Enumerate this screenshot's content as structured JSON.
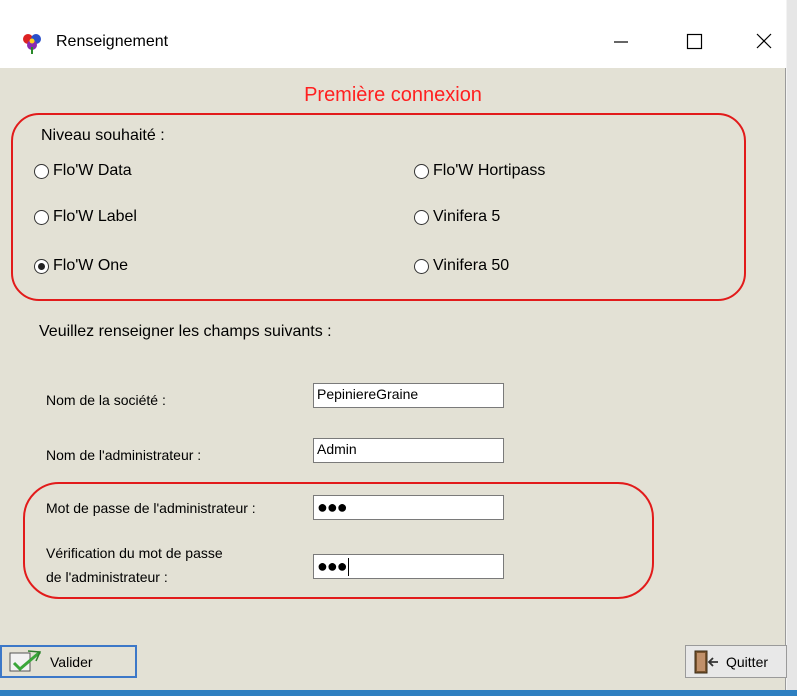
{
  "window": {
    "title": "Renseignement",
    "icon": "app-flower-icon",
    "controls": [
      "minimize-icon",
      "maximize-icon",
      "close-icon"
    ]
  },
  "heading": "Première connexion",
  "level": {
    "label": "Niveau souhaité :",
    "options": [
      {
        "label": "Flo'W Data",
        "selected": false
      },
      {
        "label": "Flo'W Label",
        "selected": false
      },
      {
        "label": "Flo'W One",
        "selected": true
      },
      {
        "label": "Flo'W Hortipass",
        "selected": false
      },
      {
        "label": "Vinifera 5",
        "selected": false
      },
      {
        "label": "Vinifera 50",
        "selected": false
      }
    ]
  },
  "form": {
    "intro": "Veuillez renseigner les champs suivants :",
    "company_label": "Nom de la société :",
    "company_value": "PepiniereGraine",
    "admin_label": "Nom de l'administrateur :",
    "admin_value": "Admin",
    "password_label": "Mot de passe de l'administrateur :",
    "password_value": "●●●",
    "verify_label_line1": "Vérification du mot de passe",
    "verify_label_line2": "de l'administrateur :",
    "verify_value": "●●●"
  },
  "buttons": {
    "validate": "Valider",
    "quit": "Quitter"
  },
  "colors": {
    "highlight_red": "#e21b1b",
    "window_bg": "#e3e1d5",
    "focus_blue": "#3c78c8"
  }
}
